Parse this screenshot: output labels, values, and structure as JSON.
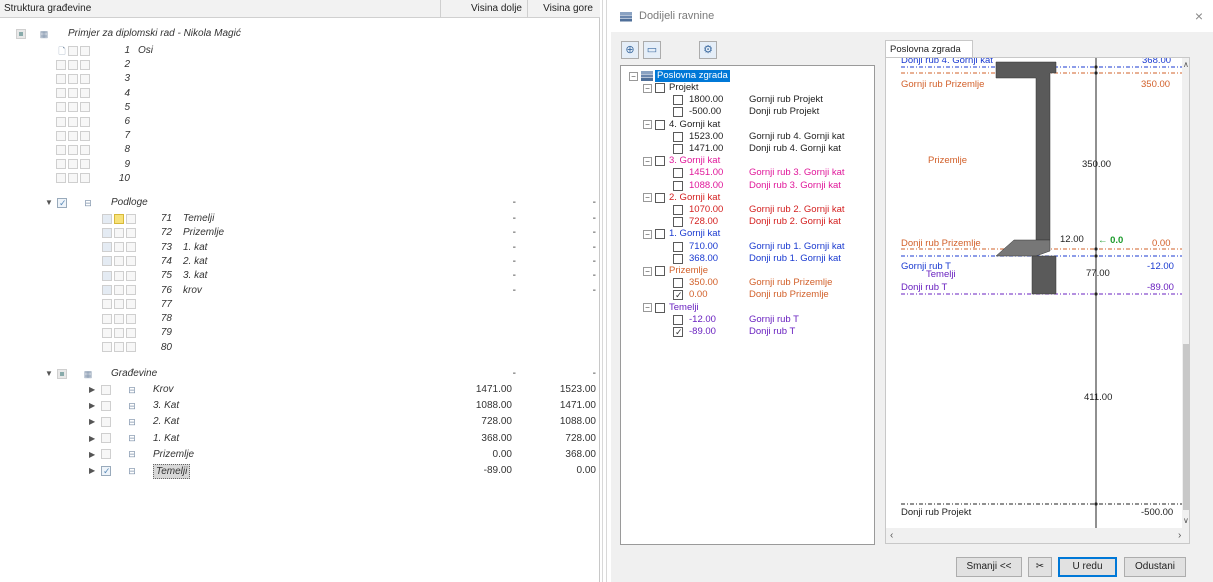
{
  "left_panel": {
    "headers": {
      "col1": "Struktura građevine",
      "col2": "Visina dolje",
      "col3": "Visina gore"
    },
    "project": "Primjer za diplomski rad - Nikola Magić",
    "axis_rows": [
      {
        "num": "1",
        "name": "Osi"
      },
      {
        "num": "2",
        "name": ""
      },
      {
        "num": "3",
        "name": ""
      },
      {
        "num": "4",
        "name": ""
      },
      {
        "num": "5",
        "name": ""
      },
      {
        "num": "6",
        "name": ""
      },
      {
        "num": "7",
        "name": ""
      },
      {
        "num": "8",
        "name": ""
      },
      {
        "num": "9",
        "name": ""
      },
      {
        "num": "10",
        "name": ""
      }
    ],
    "podloge_label": "Podloge",
    "podloge_dash": "-",
    "podloge_rows": [
      {
        "num": "71",
        "name": "Temelji",
        "lo": "-",
        "hi": "-"
      },
      {
        "num": "72",
        "name": "Prizemlje",
        "lo": "-",
        "hi": "-"
      },
      {
        "num": "73",
        "name": "1. kat",
        "lo": "-",
        "hi": "-"
      },
      {
        "num": "74",
        "name": "2. kat",
        "lo": "-",
        "hi": "-"
      },
      {
        "num": "75",
        "name": "3. kat",
        "lo": "-",
        "hi": "-"
      },
      {
        "num": "76",
        "name": "krov",
        "lo": "-",
        "hi": "-"
      },
      {
        "num": "77",
        "name": "",
        "lo": "",
        "hi": ""
      },
      {
        "num": "78",
        "name": "",
        "lo": "",
        "hi": ""
      },
      {
        "num": "79",
        "name": "",
        "lo": "",
        "hi": ""
      },
      {
        "num": "80",
        "name": "",
        "lo": "",
        "hi": ""
      }
    ],
    "gradevine_label": "Građevine",
    "gradevine_dash": "-",
    "gradevine_rows": [
      {
        "name": "Krov",
        "lo": "1471.00",
        "hi": "1523.00"
      },
      {
        "name": "3. Kat",
        "lo": "1088.00",
        "hi": "1471.00"
      },
      {
        "name": "2. Kat",
        "lo": "728.00",
        "hi": "1088.00"
      },
      {
        "name": "1. Kat",
        "lo": "368.00",
        "hi": "728.00"
      },
      {
        "name": "Prizemlje",
        "lo": "0.00",
        "hi": "368.00"
      },
      {
        "name": "Temelji",
        "lo": "-89.00",
        "hi": "0.00"
      }
    ]
  },
  "dialog": {
    "title": "Dodijeli ravnine",
    "close": "×",
    "toolbar": {
      "add": "⊕",
      "remove": "▭",
      "settings": "⚙"
    },
    "root": "Poslovna zgrada",
    "groups": [
      {
        "name": "Projekt",
        "color": "#222222",
        "items": [
          {
            "value": "1800.00",
            "label": "Gornji rub Projekt",
            "checked": false
          },
          {
            "value": "-500.00",
            "label": "Donji rub Projekt",
            "checked": false
          }
        ]
      },
      {
        "name": "4. Gornji kat",
        "color": "#222222",
        "items": [
          {
            "value": "1523.00",
            "label": "Gornji rub 4. Gornji kat",
            "checked": false
          },
          {
            "value": "1471.00",
            "label": "Donji rub 4. Gornji kat",
            "checked": false
          }
        ]
      },
      {
        "name": "3. Gornji kat",
        "color": "#e0189a",
        "items": [
          {
            "value": "1451.00",
            "label": "Gornji rub 3. Gornji kat",
            "checked": false
          },
          {
            "value": "1088.00",
            "label": "Donji rub 3. Gornji kat",
            "checked": false
          }
        ]
      },
      {
        "name": "2. Gornji kat",
        "color": "#d42020",
        "items": [
          {
            "value": "1070.00",
            "label": "Gornji rub 2. Gornji kat",
            "checked": false
          },
          {
            "value": "728.00",
            "label": "Donji rub 2. Gornji kat",
            "checked": false
          }
        ]
      },
      {
        "name": "1. Gornji kat",
        "color": "#1a3ad0",
        "items": [
          {
            "value": "710.00",
            "label": "Gornji rub 1. Gornji kat",
            "checked": false
          },
          {
            "value": "368.00",
            "label": "Donji rub 1. Gornji kat",
            "checked": false
          }
        ]
      },
      {
        "name": "Prizemlje",
        "color": "#d2602a",
        "items": [
          {
            "value": "350.00",
            "label": "Gornji rub Prizemlje",
            "checked": false
          },
          {
            "value": "0.00",
            "label": "Donji rub Prizemlje",
            "checked": true
          }
        ]
      },
      {
        "name": "Temelji",
        "color": "#6a22c0",
        "items": [
          {
            "value": "-12.00",
            "label": "Gornji rub T",
            "checked": false
          },
          {
            "value": "-89.00",
            "label": "Donji rub T",
            "checked": true
          }
        ]
      }
    ],
    "preview": {
      "tab": "Poslovna zgrada",
      "top_cut": "Donji rub 4. Gornji kat",
      "top_cut_value": "368.00",
      "gornji_prizemlje": "Gornji rub Prizemlje",
      "gornji_prizemlje_value": "350.00",
      "prizemlje": "Prizemlje",
      "dim_350": "350.00",
      "donji_prizemlje": "Donji rub Prizemlje",
      "dim_12": "12.00",
      "marker": "← 0.0",
      "donji_prizemlje_value": "0.00",
      "gornji_t": "Gornji rub T",
      "temelji": "Temelji",
      "dim_77": "77.00",
      "gornji_t_value": "-12.00",
      "donji_t": "Donji rub T",
      "donji_t_value": "-89.00",
      "dim_411": "411.00",
      "donji_projekt": "Donji rub Projekt",
      "donji_projekt_value": "-500.00",
      "colors": {
        "prizemlje": "#d2602a",
        "temelji": "#6a22c0",
        "gornji_t": "#1a3ad0"
      }
    },
    "buttons": {
      "shrink": "Smanji <<",
      "tools": "✂",
      "ok": "U redu",
      "cancel": "Odustani"
    }
  }
}
